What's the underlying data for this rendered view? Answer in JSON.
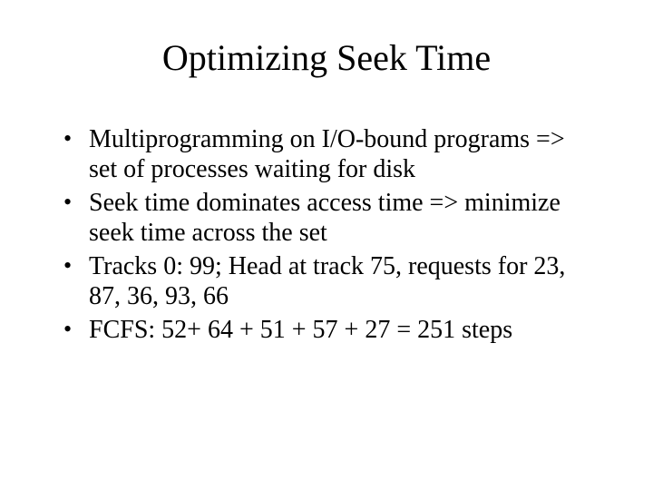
{
  "slide": {
    "title": "Optimizing Seek Time",
    "bullets": [
      "Multiprogramming on I/O-bound programs => set of processes waiting for disk",
      "Seek time dominates access time => minimize seek time across the set",
      "Tracks 0: 99; Head at track 75, requests for 23, 87, 36, 93, 66",
      "FCFS: 52+ 64 + 51 + 57 + 27 = 251 steps"
    ]
  }
}
